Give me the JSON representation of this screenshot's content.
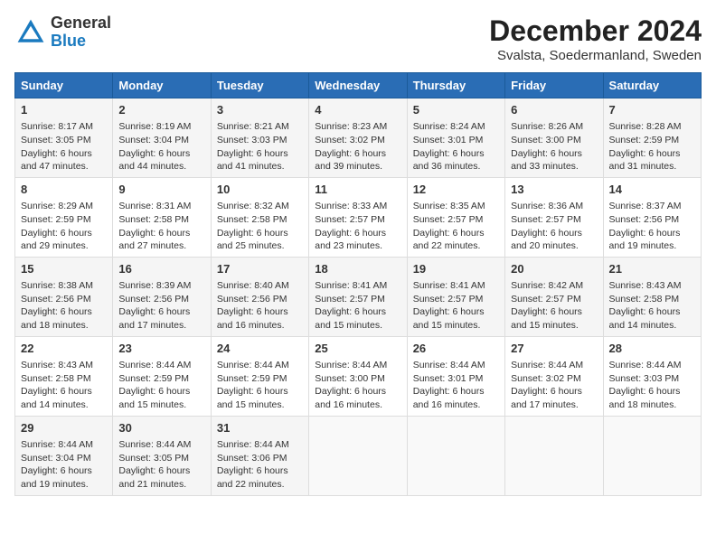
{
  "header": {
    "logo_general": "General",
    "logo_blue": "Blue",
    "month": "December 2024",
    "location": "Svalsta, Soedermanland, Sweden"
  },
  "weekdays": [
    "Sunday",
    "Monday",
    "Tuesday",
    "Wednesday",
    "Thursday",
    "Friday",
    "Saturday"
  ],
  "weeks": [
    [
      {
        "day": "1",
        "sunrise": "Sunrise: 8:17 AM",
        "sunset": "Sunset: 3:05 PM",
        "daylight": "Daylight: 6 hours and 47 minutes."
      },
      {
        "day": "2",
        "sunrise": "Sunrise: 8:19 AM",
        "sunset": "Sunset: 3:04 PM",
        "daylight": "Daylight: 6 hours and 44 minutes."
      },
      {
        "day": "3",
        "sunrise": "Sunrise: 8:21 AM",
        "sunset": "Sunset: 3:03 PM",
        "daylight": "Daylight: 6 hours and 41 minutes."
      },
      {
        "day": "4",
        "sunrise": "Sunrise: 8:23 AM",
        "sunset": "Sunset: 3:02 PM",
        "daylight": "Daylight: 6 hours and 39 minutes."
      },
      {
        "day": "5",
        "sunrise": "Sunrise: 8:24 AM",
        "sunset": "Sunset: 3:01 PM",
        "daylight": "Daylight: 6 hours and 36 minutes."
      },
      {
        "day": "6",
        "sunrise": "Sunrise: 8:26 AM",
        "sunset": "Sunset: 3:00 PM",
        "daylight": "Daylight: 6 hours and 33 minutes."
      },
      {
        "day": "7",
        "sunrise": "Sunrise: 8:28 AM",
        "sunset": "Sunset: 2:59 PM",
        "daylight": "Daylight: 6 hours and 31 minutes."
      }
    ],
    [
      {
        "day": "8",
        "sunrise": "Sunrise: 8:29 AM",
        "sunset": "Sunset: 2:59 PM",
        "daylight": "Daylight: 6 hours and 29 minutes."
      },
      {
        "day": "9",
        "sunrise": "Sunrise: 8:31 AM",
        "sunset": "Sunset: 2:58 PM",
        "daylight": "Daylight: 6 hours and 27 minutes."
      },
      {
        "day": "10",
        "sunrise": "Sunrise: 8:32 AM",
        "sunset": "Sunset: 2:58 PM",
        "daylight": "Daylight: 6 hours and 25 minutes."
      },
      {
        "day": "11",
        "sunrise": "Sunrise: 8:33 AM",
        "sunset": "Sunset: 2:57 PM",
        "daylight": "Daylight: 6 hours and 23 minutes."
      },
      {
        "day": "12",
        "sunrise": "Sunrise: 8:35 AM",
        "sunset": "Sunset: 2:57 PM",
        "daylight": "Daylight: 6 hours and 22 minutes."
      },
      {
        "day": "13",
        "sunrise": "Sunrise: 8:36 AM",
        "sunset": "Sunset: 2:57 PM",
        "daylight": "Daylight: 6 hours and 20 minutes."
      },
      {
        "day": "14",
        "sunrise": "Sunrise: 8:37 AM",
        "sunset": "Sunset: 2:56 PM",
        "daylight": "Daylight: 6 hours and 19 minutes."
      }
    ],
    [
      {
        "day": "15",
        "sunrise": "Sunrise: 8:38 AM",
        "sunset": "Sunset: 2:56 PM",
        "daylight": "Daylight: 6 hours and 18 minutes."
      },
      {
        "day": "16",
        "sunrise": "Sunrise: 8:39 AM",
        "sunset": "Sunset: 2:56 PM",
        "daylight": "Daylight: 6 hours and 17 minutes."
      },
      {
        "day": "17",
        "sunrise": "Sunrise: 8:40 AM",
        "sunset": "Sunset: 2:56 PM",
        "daylight": "Daylight: 6 hours and 16 minutes."
      },
      {
        "day": "18",
        "sunrise": "Sunrise: 8:41 AM",
        "sunset": "Sunset: 2:57 PM",
        "daylight": "Daylight: 6 hours and 15 minutes."
      },
      {
        "day": "19",
        "sunrise": "Sunrise: 8:41 AM",
        "sunset": "Sunset: 2:57 PM",
        "daylight": "Daylight: 6 hours and 15 minutes."
      },
      {
        "day": "20",
        "sunrise": "Sunrise: 8:42 AM",
        "sunset": "Sunset: 2:57 PM",
        "daylight": "Daylight: 6 hours and 15 minutes."
      },
      {
        "day": "21",
        "sunrise": "Sunrise: 8:43 AM",
        "sunset": "Sunset: 2:58 PM",
        "daylight": "Daylight: 6 hours and 14 minutes."
      }
    ],
    [
      {
        "day": "22",
        "sunrise": "Sunrise: 8:43 AM",
        "sunset": "Sunset: 2:58 PM",
        "daylight": "Daylight: 6 hours and 14 minutes."
      },
      {
        "day": "23",
        "sunrise": "Sunrise: 8:44 AM",
        "sunset": "Sunset: 2:59 PM",
        "daylight": "Daylight: 6 hours and 15 minutes."
      },
      {
        "day": "24",
        "sunrise": "Sunrise: 8:44 AM",
        "sunset": "Sunset: 2:59 PM",
        "daylight": "Daylight: 6 hours and 15 minutes."
      },
      {
        "day": "25",
        "sunrise": "Sunrise: 8:44 AM",
        "sunset": "Sunset: 3:00 PM",
        "daylight": "Daylight: 6 hours and 16 minutes."
      },
      {
        "day": "26",
        "sunrise": "Sunrise: 8:44 AM",
        "sunset": "Sunset: 3:01 PM",
        "daylight": "Daylight: 6 hours and 16 minutes."
      },
      {
        "day": "27",
        "sunrise": "Sunrise: 8:44 AM",
        "sunset": "Sunset: 3:02 PM",
        "daylight": "Daylight: 6 hours and 17 minutes."
      },
      {
        "day": "28",
        "sunrise": "Sunrise: 8:44 AM",
        "sunset": "Sunset: 3:03 PM",
        "daylight": "Daylight: 6 hours and 18 minutes."
      }
    ],
    [
      {
        "day": "29",
        "sunrise": "Sunrise: 8:44 AM",
        "sunset": "Sunset: 3:04 PM",
        "daylight": "Daylight: 6 hours and 19 minutes."
      },
      {
        "day": "30",
        "sunrise": "Sunrise: 8:44 AM",
        "sunset": "Sunset: 3:05 PM",
        "daylight": "Daylight: 6 hours and 21 minutes."
      },
      {
        "day": "31",
        "sunrise": "Sunrise: 8:44 AM",
        "sunset": "Sunset: 3:06 PM",
        "daylight": "Daylight: 6 hours and 22 minutes."
      },
      null,
      null,
      null,
      null
    ]
  ]
}
